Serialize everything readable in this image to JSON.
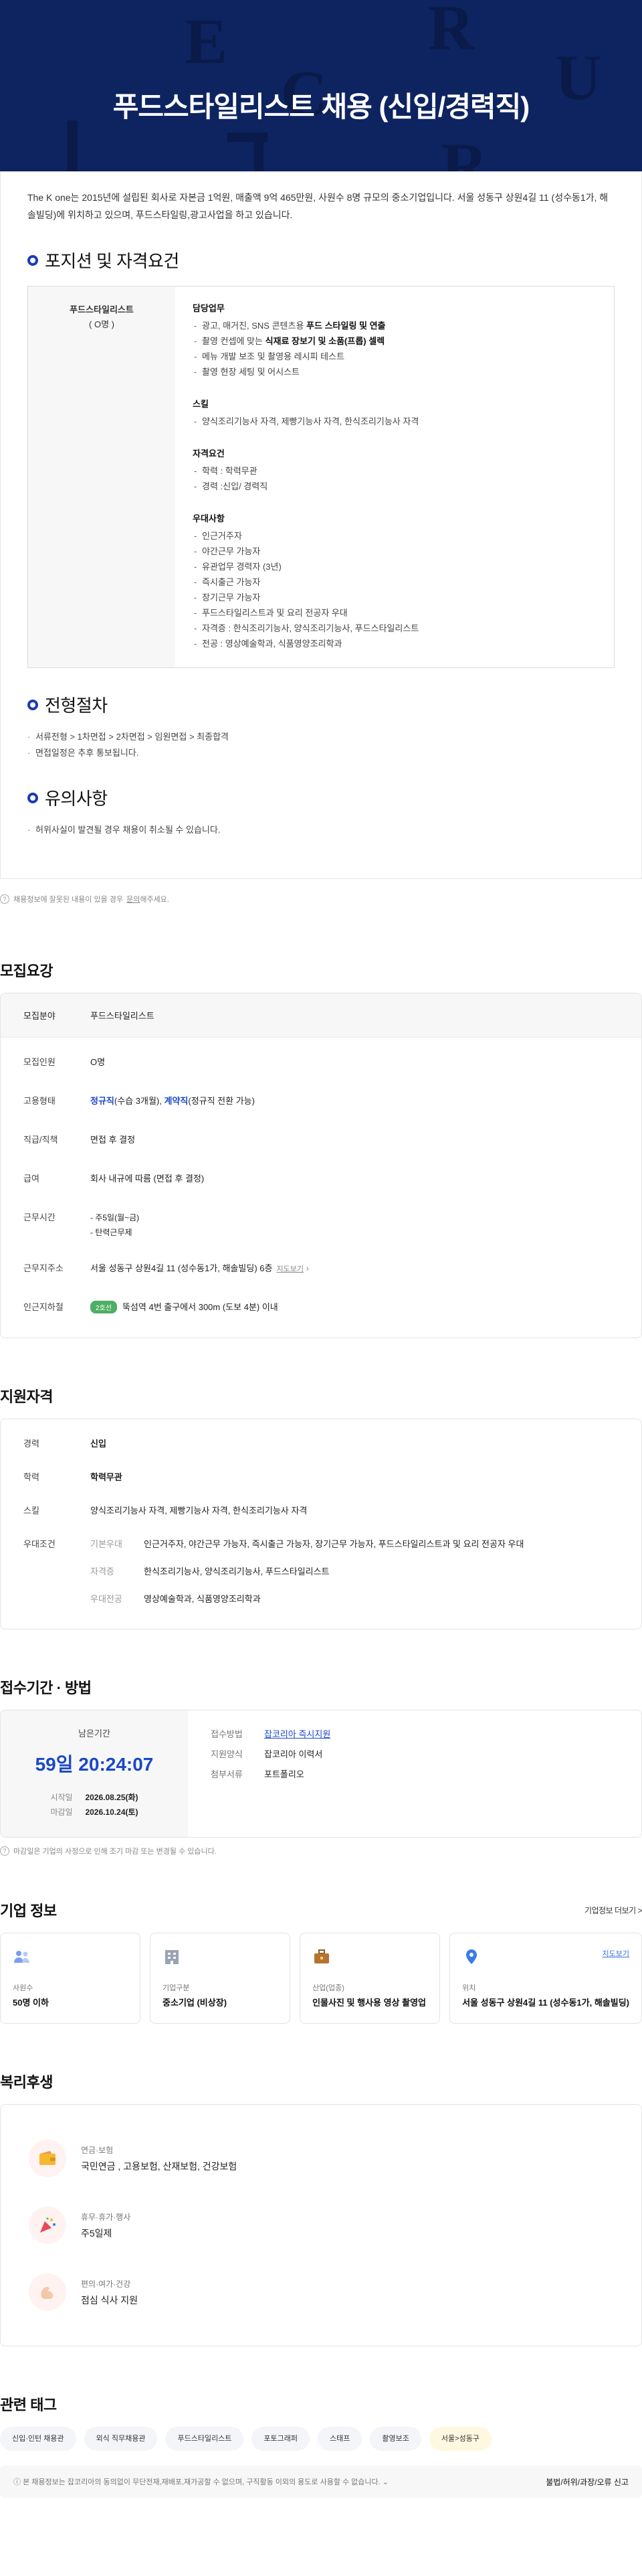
{
  "hero": {
    "title": "푸드스타일리스트 채용 (신입/경력직)"
  },
  "intro": "The K one는 2015년에 설립된 회사로 자본금 1억원, 매출액 9억 465만원, 사원수 8명 규모의 중소기업입니다. 서울 성동구 상원4길 11 (성수동1가, 해솔빌딩)에 위치하고 있으며, 푸드스타일링,광고사업을 하고 있습니다.",
  "positions": {
    "title": "포지션 및 자격요건",
    "name": "푸드스타일리스트",
    "count": "( O명 )",
    "groups": [
      {
        "title": "담당업무",
        "items": [
          {
            "pre": "광고, 매거진, SNS 콘텐츠용 ",
            "bold": "푸드 스타일링 및 연출",
            "post": ""
          },
          {
            "pre": "촬영 컨셉에 맞는 ",
            "bold": "식재료 장보기 및 소품(프롭) 셀렉",
            "post": ""
          },
          {
            "pre": "메뉴 개발 보조 및 촬영용 레시피 테스트",
            "bold": "",
            "post": ""
          },
          {
            "pre": "촬영 현장 세팅 및 어시스트",
            "bold": "",
            "post": ""
          }
        ]
      },
      {
        "title": "스킬",
        "items": [
          {
            "pre": "양식조리기능사 자격, 제빵기능사 자격, 한식조리기능사 자격",
            "bold": "",
            "post": ""
          }
        ]
      },
      {
        "title": "자격요건",
        "items": [
          {
            "pre": "학력 : 학력무관",
            "bold": "",
            "post": ""
          },
          {
            "pre": "경력 :신입/ 경력직",
            "bold": "",
            "post": ""
          }
        ]
      },
      {
        "title": "우대사항",
        "items": [
          {
            "pre": "인근거주자",
            "bold": "",
            "post": ""
          },
          {
            "pre": "야간근무 가능자",
            "bold": "",
            "post": ""
          },
          {
            "pre": "유관업무 경력자 (3년)",
            "bold": "",
            "post": ""
          },
          {
            "pre": "즉시출근 가능자",
            "bold": "",
            "post": ""
          },
          {
            "pre": "장기근무 가능자",
            "bold": "",
            "post": ""
          },
          {
            "pre": "푸드스타일리스트과 및 요리 전공자 우대",
            "bold": "",
            "post": ""
          },
          {
            "pre": "자격증 : 한식조리기능사, 양식조리기능사, 푸드스타일리스트",
            "bold": "",
            "post": ""
          },
          {
            "pre": "전공 : 영상예술학과, 식품영양조리학과",
            "bold": "",
            "post": ""
          }
        ]
      }
    ]
  },
  "process": {
    "title": "전형절차",
    "items": [
      "서류전형 > 1차면접 > 2차면접 > 임원면접 > 최종합격",
      "면접일정은 추후 통보됩니다."
    ]
  },
  "caution": {
    "title": "유의사항",
    "items": [
      "허위사실이 발견될 경우 채용이 취소될 수 있습니다."
    ]
  },
  "notice1": {
    "text": "채용정보에 잘못된 내용이 있을 경우",
    "link": "문의",
    "suffix": "해주세요."
  },
  "summary": {
    "title": "모집요강",
    "head_key": "모집분야",
    "head_val": "푸드스타일리스트",
    "recruit_key": "모집인원",
    "recruit_val": "O명",
    "emp_key": "고용형태",
    "emp_a": "정규직",
    "emp_a_note": "(수습 3개월), ",
    "emp_b": "계약직",
    "emp_b_note": "(정규직 전환 가능)",
    "rank_key": "직급/직책",
    "rank_val": "면접 후 결정",
    "pay_key": "급여",
    "pay_val": "회사 내규에 따름 (면접 후 결정)",
    "time_key": "근무시간",
    "time_items": [
      "주5일(월~금)",
      "탄력근무제"
    ],
    "addr_key": "근무지주소",
    "addr_val": "서울 성동구 상원4길 11 (성수동1가, 해솔빌딩) 6층",
    "addr_link": "지도보기",
    "station_key": "인근지하철",
    "station_badge": "2호선",
    "station_val": "뚝섬역 4번 출구에서 300m (도보 4분) 이내"
  },
  "qualification": {
    "title": "지원자격",
    "career_key": "경력",
    "career_val": "신입",
    "edu_key": "학력",
    "edu_val": "학력무관",
    "skill_key": "스킬",
    "skill_val": "양식조리기능사 자격, 제빵기능사 자격, 한식조리기능사 자격",
    "pref_key": "우대조건",
    "prefs": [
      {
        "k": "기본우대",
        "v": "인근거주자, 야간근무 가능자, 즉시출근 가능자, 장기근무 가능자, 푸드스타일리스트과 및 요리 전공자 우대"
      },
      {
        "k": "자격증",
        "v": "한식조리기능사, 양식조리기능사, 푸드스타일리스트"
      },
      {
        "k": "우대전공",
        "v": "영상예술학과, 식품영양조리학과"
      }
    ]
  },
  "period": {
    "title": "접수기간 · 방법",
    "remain_label": "남은기간",
    "remain": "59일 20:24:07",
    "start_key": "시작일",
    "start_val": "2026.08.25(화)",
    "end_key": "마감일",
    "end_val": "2026.10.24(토)",
    "method_key": "접수방법",
    "method_val": "잡코리아 즉시지원",
    "form_key": "지원양식",
    "form_val": "잡코리아 이력서",
    "doc_key": "첨부서류",
    "doc_val": "포트폴리오",
    "note": "마감일은 기업의 사정으로 인해 조기 마감 또는 변경될 수 있습니다."
  },
  "company": {
    "title": "기업 정보",
    "more": "기업정보 더보기 >",
    "boxes": [
      {
        "icon": "people-icon",
        "k": "사원수",
        "v": "50명 이하"
      },
      {
        "icon": "building-icon",
        "k": "기업구분",
        "v": "중소기업 (비상장)"
      },
      {
        "icon": "briefcase-icon",
        "k": "산업(업종)",
        "v": "인물사진 및 행사용 영상 촬영업"
      },
      {
        "icon": "pin-icon",
        "k": "위치",
        "v": "서울 성동구 상원4길 11 (성수동1가, 해솔빌딩)",
        "link": "지도보기"
      }
    ]
  },
  "welfare": {
    "title": "복리후생",
    "items": [
      {
        "icon": "wallet-icon",
        "k": "연금·보험",
        "v": "국민연금 , 고용보험, 산재보험, 건강보험"
      },
      {
        "icon": "party-icon",
        "k": "휴무·휴가·행사",
        "v": "주5일제"
      },
      {
        "icon": "muscle-icon",
        "k": "편의·여가·건강",
        "v": "점심 식사 지원"
      }
    ]
  },
  "tags": {
    "title": "관련 태그",
    "items": [
      "신입·인턴 채용관",
      "외식 직무채용관",
      "푸드스타일리스트",
      "포토그래퍼",
      "스태프",
      "촬영보조",
      "서울>성동구"
    ]
  },
  "footer": {
    "text": "본 채용정보는 잡코리아의 동의없이 무단전재,재배포,재가공할 수 없으며, 구직활동 이외의 용도로 사용할 수 없습니다.",
    "report": "불법/허위/과장/오류 신고"
  },
  "colors": {
    "hero_bg": "#0e2461",
    "accent": "#1a48c9",
    "subway_green": "#4caf63"
  }
}
